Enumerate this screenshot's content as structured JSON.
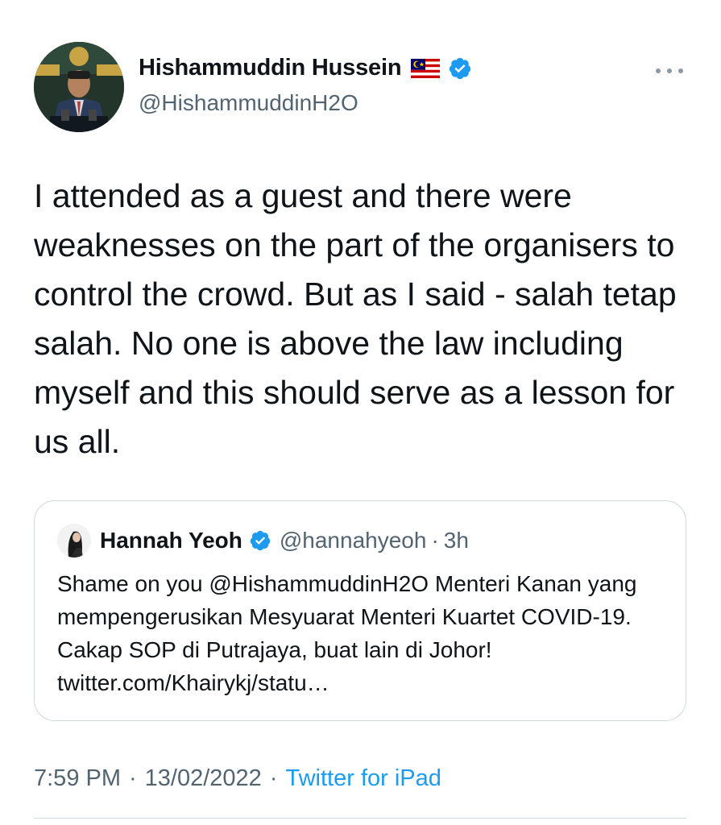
{
  "tweet": {
    "author": {
      "display_name": "Hishammuddin Hussein",
      "flag_icon": "malaysia-flag-icon",
      "handle": "@HishammuddinH2O",
      "verified": true
    },
    "text": "I attended as a guest and there were weaknesses on the part of the organisers to control the crowd. But as I said - salah tetap salah. No one is above the law including myself and this should serve as a lesson for us all.",
    "time": "7:59 PM",
    "date": "13/02/2022",
    "separator": "·",
    "source": "Twitter for iPad"
  },
  "quoted_tweet": {
    "author": {
      "display_name": "Hannah Yeoh",
      "handle": "@hannahyeoh",
      "verified": true
    },
    "separator": "·",
    "relative_time": "3h",
    "text": "Shame on you @HishammuddinH2O Menteri Kanan yang mempengerusikan Mesyuarat Menteri Kuartet COVID-19. Cakap SOP di Putrajaya, buat lain di Johor! twitter.com/Khairykj/statu…"
  },
  "colors": {
    "text_primary": "#0f1419",
    "text_secondary": "#536471",
    "link": "#1d9bf0",
    "verified": "#1d9bf0",
    "border": "#cfd9de"
  },
  "icons": {
    "verified": "verified-badge-icon",
    "more": "more-options-icon"
  }
}
